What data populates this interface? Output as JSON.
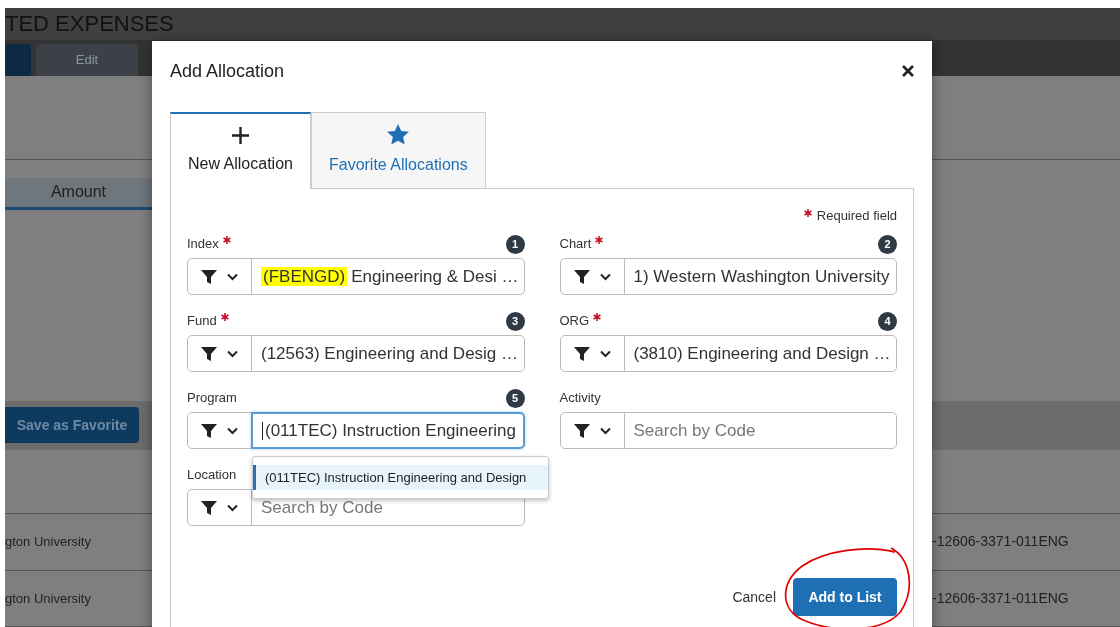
{
  "background": {
    "title": "TED EXPENSES",
    "toolbar": [
      {
        "kind": "primary"
      },
      {
        "label": "Edit",
        "kind": "secondary"
      }
    ],
    "column_header": "Amount",
    "favorite_button": "Save as Favorite",
    "rows": [
      {
        "left": "gton University",
        "right": "-12606-3371-011ENG"
      },
      {
        "left": "gton University",
        "right": "-12606-3371-011ENG"
      }
    ]
  },
  "dialog": {
    "title": "Add Allocation",
    "tabs": [
      {
        "label": "New Allocation",
        "kind": "create",
        "selected": true
      },
      {
        "label": "Favorite Allocations",
        "kind": "favorite",
        "selected": false
      }
    ],
    "legend": "Required field",
    "fields": [
      {
        "label": "Index",
        "required": true,
        "badge": "1",
        "highlight": "(FBENGD)",
        "value": "Engineering & Desi …",
        "focused": false
      },
      {
        "label": "Chart",
        "required": true,
        "badge": "2",
        "value": "1) Western Washington University",
        "focused": false
      },
      {
        "label": "Fund",
        "required": true,
        "badge": "3",
        "value": "(12563) Engineering and Desig …",
        "focused": false
      },
      {
        "label": "ORG",
        "required": true,
        "badge": "4",
        "value": "(3810) Engineering and Design …",
        "focused": false
      },
      {
        "label": "Program",
        "required": false,
        "badge": "5",
        "value": "(011TEC) Instruction Engineering",
        "focused": true,
        "suggestions": [
          {
            "label": "(011TEC) Instruction Engineering and Design",
            "selected": true
          }
        ]
      },
      {
        "label": "Activity",
        "required": false,
        "placeholder": "Search by Code",
        "focused": false
      },
      {
        "label": "Location",
        "required": false,
        "placeholder": "Search by Code",
        "focused": false
      }
    ],
    "cancel": "Cancel",
    "submit": "Add to List"
  }
}
